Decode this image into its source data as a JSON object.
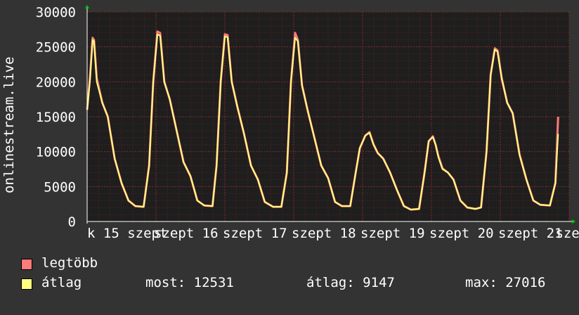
{
  "chart_data": {
    "type": "area",
    "ylabel": "onlinestream.live",
    "ylim": [
      0,
      30000
    ],
    "yticks": [
      0,
      5000,
      10000,
      15000,
      20000,
      25000,
      30000
    ],
    "ytick_labels": [
      "0",
      "5000",
      "10000",
      "15000",
      "20000",
      "25000",
      "30000"
    ],
    "xlim_days": [
      0,
      7
    ],
    "x_tick_labels_raw": [
      "k 15 szept",
      "szept 16",
      "szept 17",
      "szept 18",
      "szept 19",
      "szept 20",
      "szept 21",
      "szept"
    ],
    "grid": true,
    "colors": {
      "background": "#333333",
      "plot_bg": "#1e1e1e",
      "grid": "#5a2020",
      "grid_major": "#7a2a2a",
      "max_series": "#ff7a7a",
      "avg_series": "#ffff80",
      "axis": "#ffffff"
    },
    "series": [
      {
        "name": "legtöbb",
        "color": "#ff7a7a",
        "points": [
          [
            0.0,
            16000
          ],
          [
            0.04,
            20500
          ],
          [
            0.08,
            26300
          ],
          [
            0.1,
            26000
          ],
          [
            0.14,
            20500
          ],
          [
            0.22,
            17000
          ],
          [
            0.3,
            15000
          ],
          [
            0.4,
            9000
          ],
          [
            0.5,
            5500
          ],
          [
            0.6,
            3000
          ],
          [
            0.7,
            2200
          ],
          [
            0.82,
            2100
          ],
          [
            0.9,
            8000
          ],
          [
            0.96,
            20000
          ],
          [
            1.02,
            27200
          ],
          [
            1.06,
            27000
          ],
          [
            1.12,
            20000
          ],
          [
            1.2,
            17500
          ],
          [
            1.3,
            13000
          ],
          [
            1.4,
            8500
          ],
          [
            1.5,
            6500
          ],
          [
            1.6,
            3000
          ],
          [
            1.7,
            2300
          ],
          [
            1.82,
            2200
          ],
          [
            1.88,
            8000
          ],
          [
            1.94,
            20000
          ],
          [
            2.0,
            26800
          ],
          [
            2.04,
            26700
          ],
          [
            2.1,
            20000
          ],
          [
            2.18,
            16500
          ],
          [
            2.28,
            12500
          ],
          [
            2.38,
            8000
          ],
          [
            2.48,
            6000
          ],
          [
            2.58,
            2800
          ],
          [
            2.7,
            2100
          ],
          [
            2.82,
            2100
          ],
          [
            2.9,
            7000
          ],
          [
            2.96,
            20000
          ],
          [
            3.02,
            27000
          ],
          [
            3.06,
            26000
          ],
          [
            3.12,
            19500
          ],
          [
            3.2,
            16000
          ],
          [
            3.3,
            12000
          ],
          [
            3.4,
            8000
          ],
          [
            3.5,
            6200
          ],
          [
            3.6,
            2800
          ],
          [
            3.7,
            2200
          ],
          [
            3.82,
            2200
          ],
          [
            3.9,
            7000
          ],
          [
            3.96,
            10500
          ],
          [
            4.04,
            12300
          ],
          [
            4.1,
            12800
          ],
          [
            4.16,
            11000
          ],
          [
            4.22,
            9800
          ],
          [
            4.3,
            9000
          ],
          [
            4.4,
            7000
          ],
          [
            4.5,
            4500
          ],
          [
            4.6,
            2200
          ],
          [
            4.7,
            1700
          ],
          [
            4.82,
            1800
          ],
          [
            4.9,
            7000
          ],
          [
            4.96,
            11500
          ],
          [
            5.02,
            12200
          ],
          [
            5.06,
            11000
          ],
          [
            5.1,
            9400
          ],
          [
            5.16,
            7600
          ],
          [
            5.24,
            7000
          ],
          [
            5.32,
            6000
          ],
          [
            5.42,
            3000
          ],
          [
            5.52,
            2000
          ],
          [
            5.64,
            1800
          ],
          [
            5.72,
            2000
          ],
          [
            5.8,
            10000
          ],
          [
            5.86,
            21000
          ],
          [
            5.92,
            24800
          ],
          [
            5.96,
            24500
          ],
          [
            6.02,
            20500
          ],
          [
            6.1,
            17000
          ],
          [
            6.18,
            15500
          ],
          [
            6.28,
            9600
          ],
          [
            6.38,
            6000
          ],
          [
            6.48,
            3000
          ],
          [
            6.58,
            2400
          ],
          [
            6.72,
            2300
          ],
          [
            6.8,
            5500
          ],
          [
            6.84,
            15000
          ]
        ]
      },
      {
        "name": "átlag",
        "color": "#ffff80",
        "points": [
          [
            0.0,
            16000
          ],
          [
            0.04,
            20000
          ],
          [
            0.08,
            26000
          ],
          [
            0.1,
            25800
          ],
          [
            0.14,
            20000
          ],
          [
            0.22,
            17000
          ],
          [
            0.3,
            15000
          ],
          [
            0.4,
            9000
          ],
          [
            0.5,
            5500
          ],
          [
            0.6,
            3000
          ],
          [
            0.7,
            2200
          ],
          [
            0.82,
            2100
          ],
          [
            0.9,
            8000
          ],
          [
            0.96,
            20000
          ],
          [
            1.02,
            26800
          ],
          [
            1.06,
            26600
          ],
          [
            1.12,
            20000
          ],
          [
            1.2,
            17500
          ],
          [
            1.3,
            13000
          ],
          [
            1.4,
            8500
          ],
          [
            1.5,
            6500
          ],
          [
            1.6,
            3000
          ],
          [
            1.7,
            2300
          ],
          [
            1.82,
            2200
          ],
          [
            1.88,
            8000
          ],
          [
            1.94,
            20000
          ],
          [
            2.0,
            26500
          ],
          [
            2.04,
            26400
          ],
          [
            2.1,
            20000
          ],
          [
            2.18,
            16500
          ],
          [
            2.28,
            12500
          ],
          [
            2.38,
            8000
          ],
          [
            2.48,
            6000
          ],
          [
            2.58,
            2800
          ],
          [
            2.7,
            2100
          ],
          [
            2.82,
            2100
          ],
          [
            2.9,
            7000
          ],
          [
            2.96,
            20000
          ],
          [
            3.02,
            26300
          ],
          [
            3.06,
            25800
          ],
          [
            3.12,
            19500
          ],
          [
            3.2,
            16000
          ],
          [
            3.3,
            12000
          ],
          [
            3.4,
            8000
          ],
          [
            3.5,
            6200
          ],
          [
            3.6,
            2800
          ],
          [
            3.7,
            2200
          ],
          [
            3.82,
            2200
          ],
          [
            3.9,
            7000
          ],
          [
            3.96,
            10500
          ],
          [
            4.04,
            12300
          ],
          [
            4.1,
            12700
          ],
          [
            4.16,
            11000
          ],
          [
            4.22,
            9800
          ],
          [
            4.3,
            9000
          ],
          [
            4.4,
            7000
          ],
          [
            4.5,
            4500
          ],
          [
            4.6,
            2200
          ],
          [
            4.7,
            1700
          ],
          [
            4.82,
            1800
          ],
          [
            4.9,
            7000
          ],
          [
            4.96,
            11500
          ],
          [
            5.02,
            12100
          ],
          [
            5.06,
            11000
          ],
          [
            5.1,
            9200
          ],
          [
            5.16,
            7500
          ],
          [
            5.24,
            7000
          ],
          [
            5.32,
            6000
          ],
          [
            5.42,
            3000
          ],
          [
            5.52,
            2000
          ],
          [
            5.64,
            1800
          ],
          [
            5.72,
            2000
          ],
          [
            5.8,
            10000
          ],
          [
            5.86,
            21000
          ],
          [
            5.92,
            24600
          ],
          [
            5.96,
            24300
          ],
          [
            6.02,
            20500
          ],
          [
            6.1,
            17000
          ],
          [
            6.18,
            15500
          ],
          [
            6.28,
            9500
          ],
          [
            6.38,
            6000
          ],
          [
            6.48,
            3000
          ],
          [
            6.58,
            2400
          ],
          [
            6.72,
            2300
          ],
          [
            6.8,
            5500
          ],
          [
            6.84,
            12531
          ]
        ]
      }
    ]
  },
  "legend": {
    "max_label": "legtöbb",
    "avg_label": "átlag",
    "max_color": "#ff7a7a",
    "avg_color": "#ffff80"
  },
  "stats": {
    "current": "most: 12531",
    "average": "átlag: 9147",
    "maximum": "max: 27016"
  }
}
